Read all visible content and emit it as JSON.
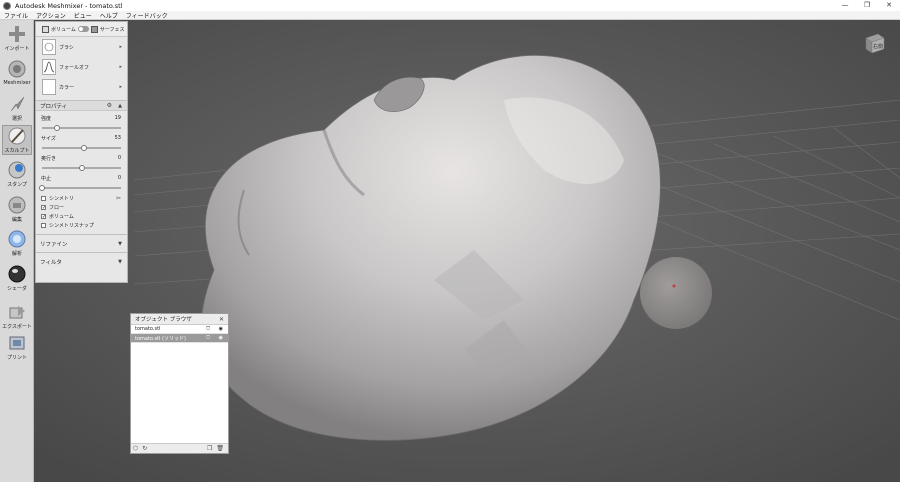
{
  "window": {
    "title": "Autodesk Meshmixer - tomato.stl",
    "controls": [
      "—",
      "❐",
      "✕"
    ]
  },
  "menu": [
    "ファイル",
    "アクション",
    "ビュー",
    "ヘルプ",
    "フィードバック"
  ],
  "tools": [
    {
      "label": "インポート",
      "icon": "plus-icon"
    },
    {
      "label": "Meshmixer",
      "icon": "meshmixer-icon"
    },
    {
      "label": "選択",
      "icon": "select-arrow-icon"
    },
    {
      "label": "スカルプト",
      "icon": "sculpt-brush-icon"
    },
    {
      "label": "スタンプ",
      "icon": "stamp-icon"
    },
    {
      "label": "編集",
      "icon": "edit-icon"
    },
    {
      "label": "解析",
      "icon": "analysis-icon"
    },
    {
      "label": "シェーダ",
      "icon": "shader-ball-icon"
    },
    {
      "label": "エクスポート",
      "icon": "export-icon"
    },
    {
      "label": "プリント",
      "icon": "print-icon"
    }
  ],
  "sculpt_panel": {
    "mode_volume": "ボリューム",
    "mode_surface": "サーフェス",
    "brushes": [
      {
        "label": "ブラシ"
      },
      {
        "label": "フォールオフ"
      },
      {
        "label": "カラー"
      }
    ],
    "properties_title": "プロパティ",
    "properties": [
      {
        "label": "強度",
        "value": "19",
        "level": 0.19
      },
      {
        "label": "サイズ",
        "value": "53",
        "level": 0.53
      },
      {
        "label": "奥行き",
        "value": "0",
        "level": 0.5
      },
      {
        "label": "中止",
        "value": "0",
        "level": 0.0
      }
    ],
    "checks": [
      {
        "label": "シンメトリ",
        "checked": false
      },
      {
        "label": "フロー",
        "checked": true
      },
      {
        "label": "ボリューム",
        "checked": true
      },
      {
        "label": "シンメトリスナップ",
        "checked": false
      }
    ],
    "refine": "リファイン",
    "filter": "フィルタ"
  },
  "object_browser": {
    "title": "オブジェクト ブラウザ",
    "items": [
      {
        "name": "tomato.stl",
        "selected": false
      },
      {
        "name": "tomato.stl (ソリッド)",
        "selected": true
      }
    ]
  },
  "viewcube": {
    "label": "右側"
  }
}
